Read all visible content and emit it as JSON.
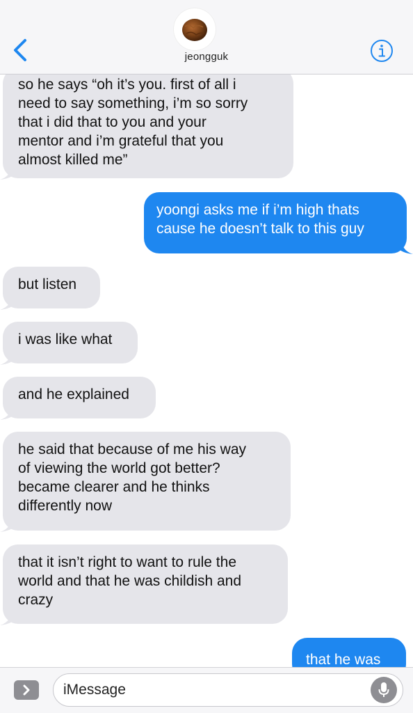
{
  "header": {
    "contact_name": "jeongguk",
    "back_icon": "chevron-left-icon",
    "info_icon": "info-icon",
    "avatar_desc": "coconut avatar"
  },
  "messages": [
    {
      "direction": "incoming",
      "lines": [
        "so he says “oh it’s you. first of all i",
        "need to say something, i’m so sorry",
        "that i did that to you and your",
        "mentor and i’m grateful that you",
        "almost killed me”"
      ]
    },
    {
      "direction": "outgoing",
      "lines": [
        "yoongi asks me if i’m high thats",
        "cause he doesn’t talk to this guy"
      ]
    },
    {
      "direction": "incoming",
      "lines": [
        "but listen"
      ]
    },
    {
      "direction": "incoming",
      "lines": [
        "i was like what"
      ]
    },
    {
      "direction": "incoming",
      "lines": [
        "and he explained"
      ]
    },
    {
      "direction": "incoming",
      "lines": [
        "he said that because of me his way",
        "of viewing the world got better?",
        "became clearer and he thinks",
        "differently now"
      ]
    },
    {
      "direction": "incoming",
      "lines": [
        "that it isn’t right to want to rule the",
        "world and that he was childish and",
        "crazy"
      ]
    },
    {
      "direction": "outgoing",
      "lines": [
        "that he was"
      ]
    }
  ],
  "input_bar": {
    "placeholder": "iMessage",
    "apps_icon": "chevron-right-icon",
    "mic_icon": "microphone-icon"
  },
  "colors": {
    "incoming_bubble": "#e5e5ea",
    "outgoing_bubble": "#1e87f0",
    "accent": "#1e87f0",
    "header_bg": "#f6f6f8"
  }
}
